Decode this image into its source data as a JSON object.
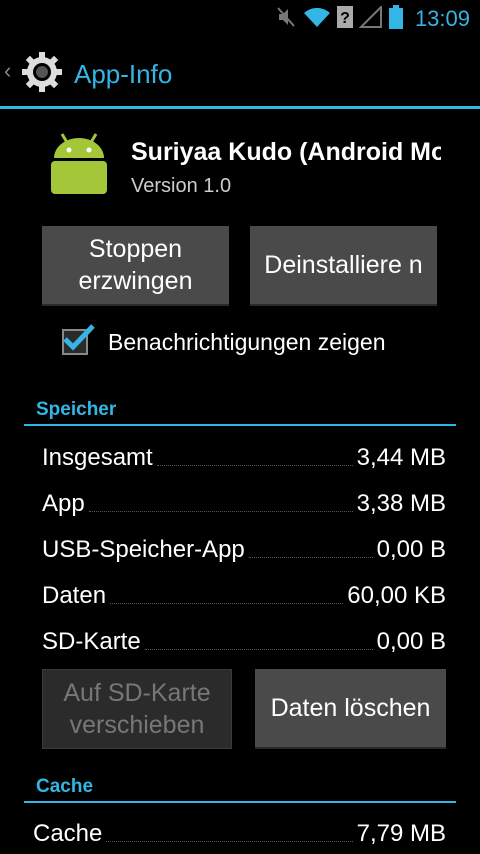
{
  "status_bar": {
    "time": "13:09",
    "accent": "#33b5e5"
  },
  "action_bar": {
    "title": "App-Info"
  },
  "app": {
    "name": "Suriyaa Kudo (Android Mo",
    "version": "Version 1.0"
  },
  "buttons": {
    "force_stop": "Stoppen erzwingen",
    "uninstall": "Deinstalliere n",
    "move_to_sd": "Auf SD-Karte verschieben",
    "clear_data": "Daten löschen"
  },
  "notifications": {
    "label": "Benachrichtigungen zeigen",
    "checked": true
  },
  "storage": {
    "header": "Speicher",
    "rows": [
      {
        "label": "Insgesamt",
        "value": "3,44 MB"
      },
      {
        "label": "App",
        "value": "3,38 MB"
      },
      {
        "label": "USB-Speicher-App",
        "value": "0,00 B"
      },
      {
        "label": "Daten",
        "value": "60,00 KB"
      },
      {
        "label": "SD-Karte",
        "value": "0,00 B"
      }
    ]
  },
  "cache": {
    "header": "Cache",
    "rows": [
      {
        "label": "Cache",
        "value": "7,79 MB"
      }
    ]
  }
}
